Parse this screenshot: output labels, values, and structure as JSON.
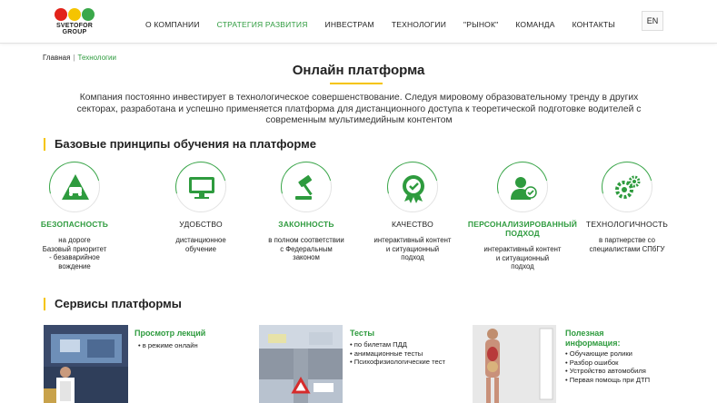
{
  "header": {
    "logo_text": "SVETOFOR GROUP",
    "nav": [
      {
        "label": "О КОМПАНИИ",
        "active": false
      },
      {
        "label": "СТРАТЕГИЯ РАЗВИТИЯ",
        "active": true
      },
      {
        "label": "ИНВЕСТРАМ",
        "active": false
      },
      {
        "label": "ТЕХНОЛОГИИ",
        "active": false
      },
      {
        "label": "\"РЫНОК\"",
        "active": false
      },
      {
        "label": "КОМАНДА",
        "active": false
      },
      {
        "label": "КОНТАКТЫ",
        "active": false
      }
    ],
    "lang": "EN"
  },
  "breadcrumb": {
    "home": "Главная",
    "separator": "|",
    "current": "Технологии"
  },
  "page_title": "Онлайн платформа",
  "intro": "Компания постоянно инвестирует в технологическое совершенствование. Следуя мировому образовательному тренду в других секторах, разработана и успешно применяется платформа для дистанционного доступа к теоретической подготовке водителей с современным мультимедийным контентом",
  "principles_title": "Базовые принципы обучения на платформе",
  "principles": [
    {
      "icon": "road-icon",
      "title": "БЕЗОПАСНОСТЬ",
      "green": true,
      "desc": "на дороге\nБазовый приоритет\n- безаварийное\nвождение"
    },
    {
      "icon": "computer-icon",
      "title": "УДОБСТВО",
      "green": false,
      "desc": "дистанционное\nобучение"
    },
    {
      "icon": "gavel-icon",
      "title": "ЗАКОННОСТЬ",
      "green": true,
      "desc": "в полном соответствии\nс Федеральным\nзаконом"
    },
    {
      "icon": "quality-badge-icon",
      "title": "КАЧЕСТВО",
      "green": false,
      "desc": "интерактивный контент\nи ситуационный\nподход"
    },
    {
      "icon": "person-check-icon",
      "title": "ПЕРСОНАЛИЗИРОВАННЫЙ\nПОДХОД",
      "green": true,
      "desc": "интерактивный контент\nи ситуационный\nподход"
    },
    {
      "icon": "gears-icon",
      "title": "ТЕХНОЛОГИЧНОСТЬ",
      "green": false,
      "desc": "в партнерстве со\nспециалистами СПбГУ"
    }
  ],
  "services_title": "Сервисы платформы",
  "services": [
    {
      "title": "Просмотр лекций",
      "items": [
        "в режиме онлайн"
      ]
    },
    {
      "title": "Тесты",
      "items": [
        "по билетам ПДД",
        "анимационные тесты",
        "Психофизиологические тест"
      ]
    },
    {
      "title": "Полезная\nинформация:",
      "items": [
        "Обучающие ролики",
        "Разбор ошибок",
        "Устройство автомобиля",
        "Первая помощь при ДТП"
      ]
    }
  ],
  "colors": {
    "accent_green": "#2e9b3e",
    "accent_yellow": "#f5c400"
  }
}
